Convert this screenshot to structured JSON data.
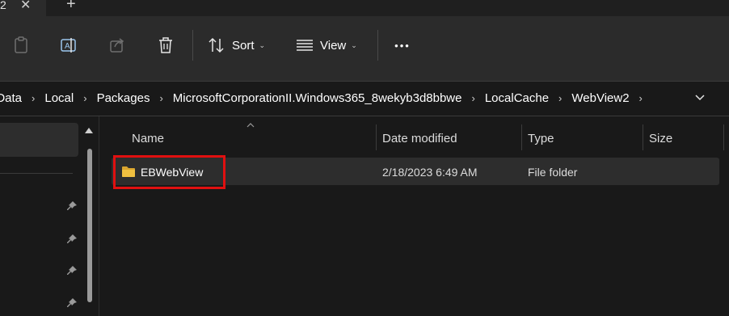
{
  "tab": {
    "title": "2",
    "close_glyph": "✕",
    "new_tab_glyph": "+"
  },
  "toolbar": {
    "copy_icon": "clipboard-icon",
    "rename_icon": "rename-icon",
    "share_icon": "share-icon",
    "delete_icon": "trash-icon",
    "sort_label": "Sort",
    "view_label": "View",
    "more_label": "•••"
  },
  "breadcrumb": [
    "pData",
    "Local",
    "Packages",
    "MicrosoftCorporationII.Windows365_8wekyb3d8bbwe",
    "LocalCache",
    "WebView2"
  ],
  "columns": {
    "name": "Name",
    "date": "Date modified",
    "type": "Type",
    "size": "Size"
  },
  "rows": [
    {
      "name": "EBWebView",
      "date": "2/18/2023 6:49 AM",
      "type": "File folder",
      "size": ""
    }
  ],
  "colors": {
    "background": "#191919",
    "toolbar": "#2b2b2b",
    "highlight": "#e01010",
    "folder": "#f0c040"
  }
}
